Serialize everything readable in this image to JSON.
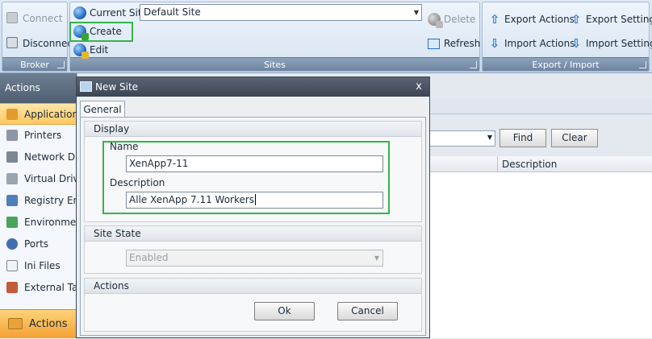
{
  "ribbon": {
    "broker": {
      "caption": "Broker",
      "connect_label": "Connect",
      "disconnect_label": "Disconnect"
    },
    "sites": {
      "caption": "Sites",
      "current_site_label": "Current Site",
      "current_site_value": "Default Site",
      "create_label": "Create",
      "edit_label": "Edit",
      "delete_label": "Delete",
      "refresh_label": "Refresh"
    },
    "export_import": {
      "caption": "Export / Import",
      "export_actions_label": "Export Actions",
      "import_actions_label": "Import Actions",
      "export_settings_label": "Export Settings",
      "import_settings_label": "Import Settings"
    }
  },
  "sidebar": {
    "header": "Actions",
    "items": [
      {
        "label": "Applications",
        "icon": "applications-icon",
        "active": true
      },
      {
        "label": "Printers",
        "icon": "printer-icon"
      },
      {
        "label": "Network Drives",
        "icon": "network-drive-icon"
      },
      {
        "label": "Virtual Drives",
        "icon": "virtual-drive-icon"
      },
      {
        "label": "Registry Entries",
        "icon": "registry-icon"
      },
      {
        "label": "Environment",
        "icon": "environment-icon"
      },
      {
        "label": "Ports",
        "icon": "port-icon"
      },
      {
        "label": "Ini Files",
        "icon": "ini-file-icon"
      },
      {
        "label": "External Tasks",
        "icon": "external-task-icon"
      }
    ],
    "footer": "Actions"
  },
  "background": {
    "find_label": "Find",
    "clear_label": "Clear",
    "column_description": "Description"
  },
  "dialog": {
    "title": "New Site",
    "close_glyph": "x",
    "tab_general": "General",
    "display": {
      "heading": "Display",
      "name_label": "Name",
      "name_value": "XenApp7-11",
      "description_label": "Description",
      "description_value": "Alle XenApp 7.11 Workers"
    },
    "site_state": {
      "heading": "Site State",
      "value": "Enabled"
    },
    "actions": {
      "heading": "Actions",
      "ok_label": "Ok",
      "cancel_label": "Cancel"
    }
  },
  "colors": {
    "highlight": "#36b34a",
    "active_nav": "#ffc760",
    "titlebar": "#3c4553"
  }
}
